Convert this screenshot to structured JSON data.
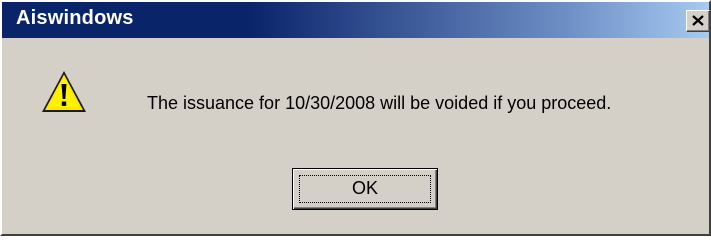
{
  "window": {
    "title": "Aiswindows",
    "title_bar_color": "#0a246a",
    "face_color": "#d4d0c8"
  },
  "title_bar_buttons": {
    "close_icon": "close-icon"
  },
  "dialog": {
    "icon": "warning-icon",
    "message": "The issuance for 10/30/2008 will be voided if you proceed.",
    "ok_label": "OK"
  }
}
